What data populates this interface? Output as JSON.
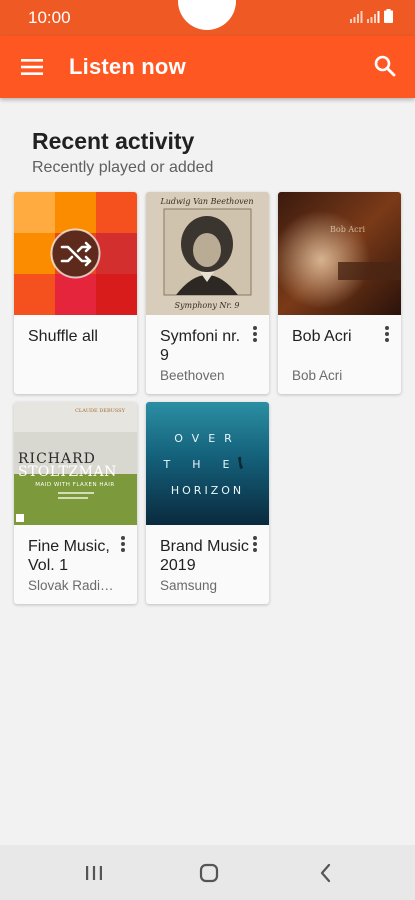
{
  "status_bar": {
    "time": "10:00"
  },
  "app_bar": {
    "title": "Listen now"
  },
  "section": {
    "title": "Recent activity",
    "subtitle": "Recently played or added"
  },
  "cards": [
    {
      "title": "Shuffle all",
      "subtitle": ""
    },
    {
      "title": "Symfoni nr. 9",
      "subtitle": "Beethoven",
      "art_text_top": "Ludwig Van Beethoven",
      "art_text_bottom": "Symphony Nr. 9"
    },
    {
      "title": "Bob Acri",
      "subtitle": "Bob Acri",
      "art_text": "Bob Acri"
    },
    {
      "title": "Fine Music, Vol. 1",
      "subtitle": "Slovak Radio Symphony Orchestra",
      "art_text_top": "CLAUDE DEBUSSY",
      "art_text_main1": "RICHARD",
      "art_text_main2": "STOLTZMAN",
      "art_text_sub": "MAID WITH FLAXEN HAIR"
    },
    {
      "title": "Brand Music 2019",
      "subtitle": "Samsung",
      "art_text_1": "OVER",
      "art_text_2": "THE",
      "art_text_3": "HORIZON"
    }
  ],
  "colors": {
    "accent": "#ff5722",
    "status_bar": "#ef5a24"
  },
  "icons": {
    "menu": "menu-icon",
    "search": "search-icon",
    "shuffle": "shuffle-icon",
    "more": "more-vert-icon",
    "recents": "recents-icon",
    "home": "home-icon",
    "back": "back-icon"
  }
}
